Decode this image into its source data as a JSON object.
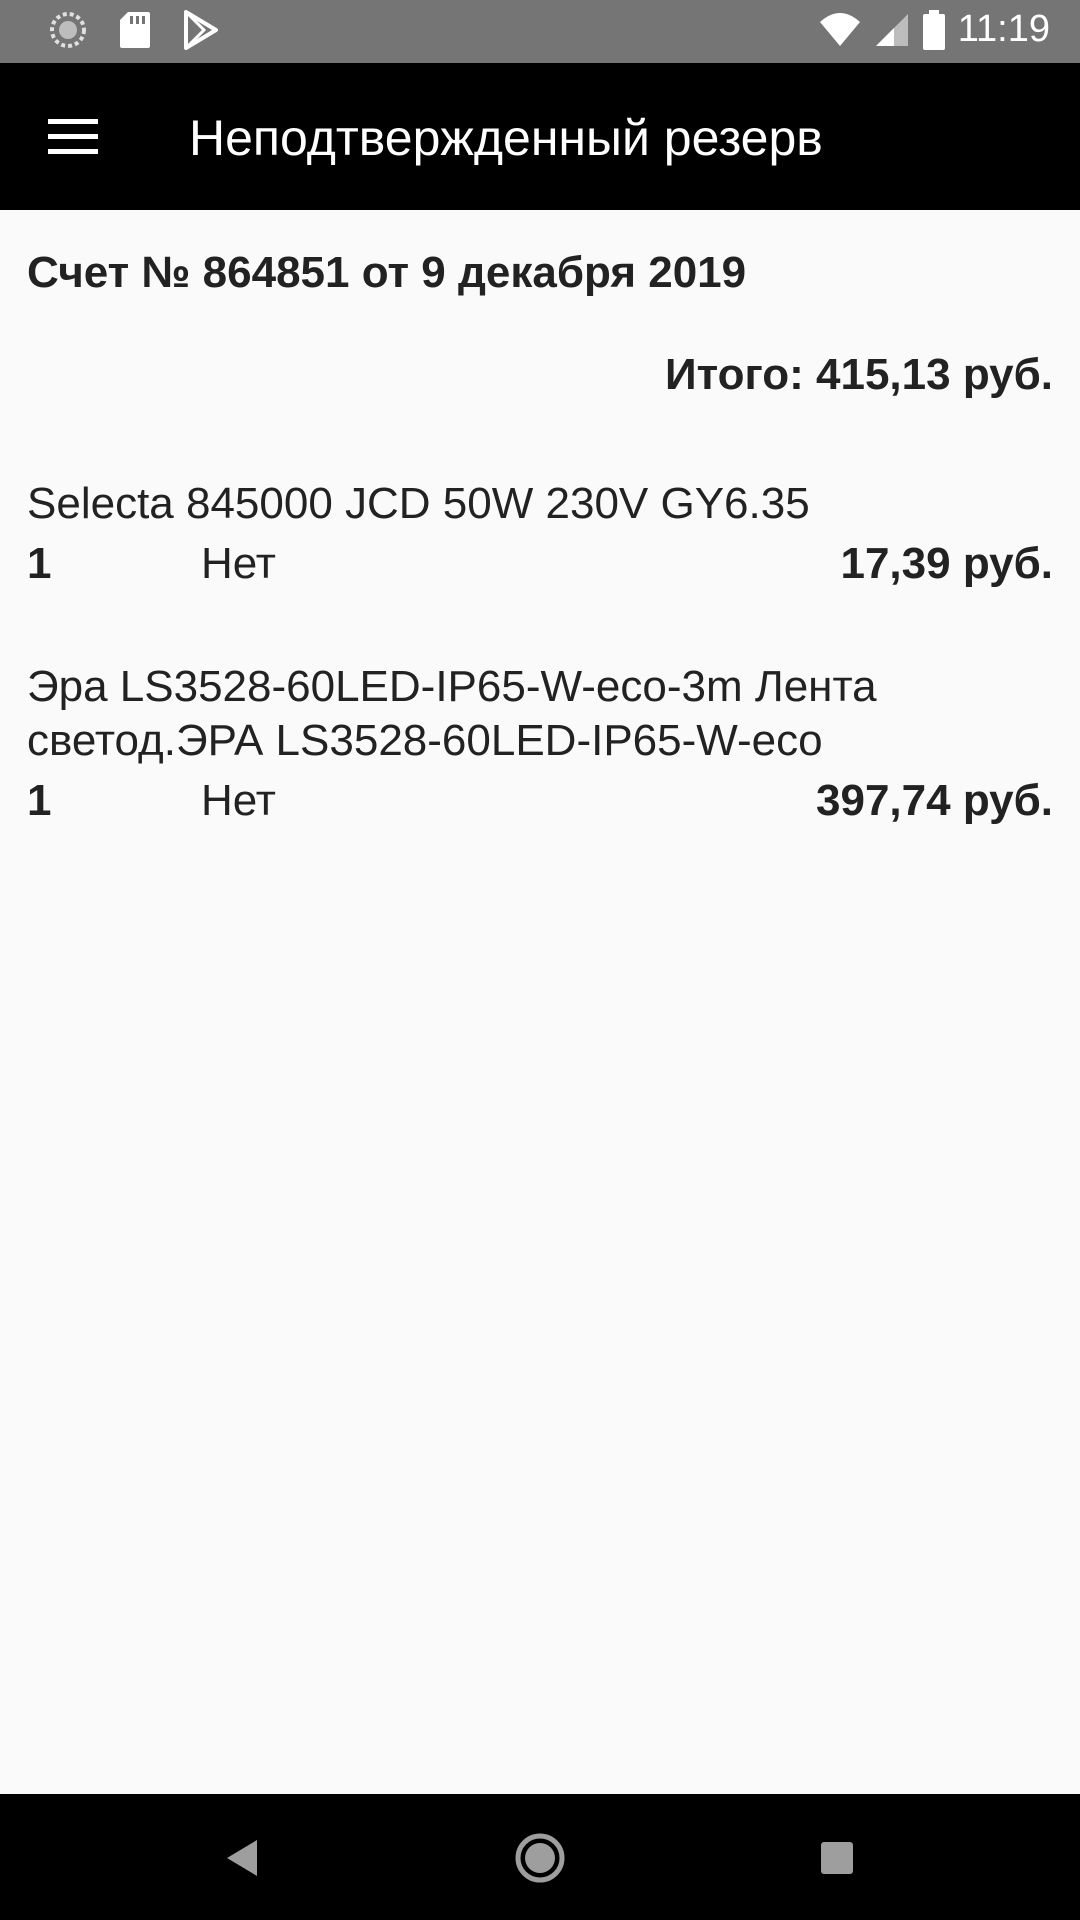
{
  "status_bar": {
    "time": "11:19",
    "icons_left": [
      "sync-icon",
      "sd-card-icon",
      "play-store-icon"
    ],
    "icons_right": [
      "wifi-icon",
      "signal-icon",
      "battery-icon"
    ]
  },
  "app_bar": {
    "menu_icon": "hamburger-menu-icon",
    "title": "Неподтвержденный резерв"
  },
  "invoice": {
    "title": "Счет № 864851 от 9 декабря 2019",
    "total_label": "Итого:",
    "total_value": "415,13 руб."
  },
  "items": [
    {
      "name": "Selecta 845000 JCD 50W 230V GY6.35",
      "qty": "1",
      "availability": "Нет",
      "price": "17,39 руб."
    },
    {
      "name_line1": "Эра LS3528-60LED-IP65-W-eco-3m Лента",
      "name_line2": "светод.ЭРА LS3528-60LED-IP65-W-eco",
      "qty": "1",
      "availability": "Нет",
      "price": "397,74 руб."
    }
  ],
  "nav_bar": {
    "back_icon": "back-triangle-icon",
    "home_icon": "home-circle-icon",
    "recents_icon": "recents-square-icon"
  }
}
